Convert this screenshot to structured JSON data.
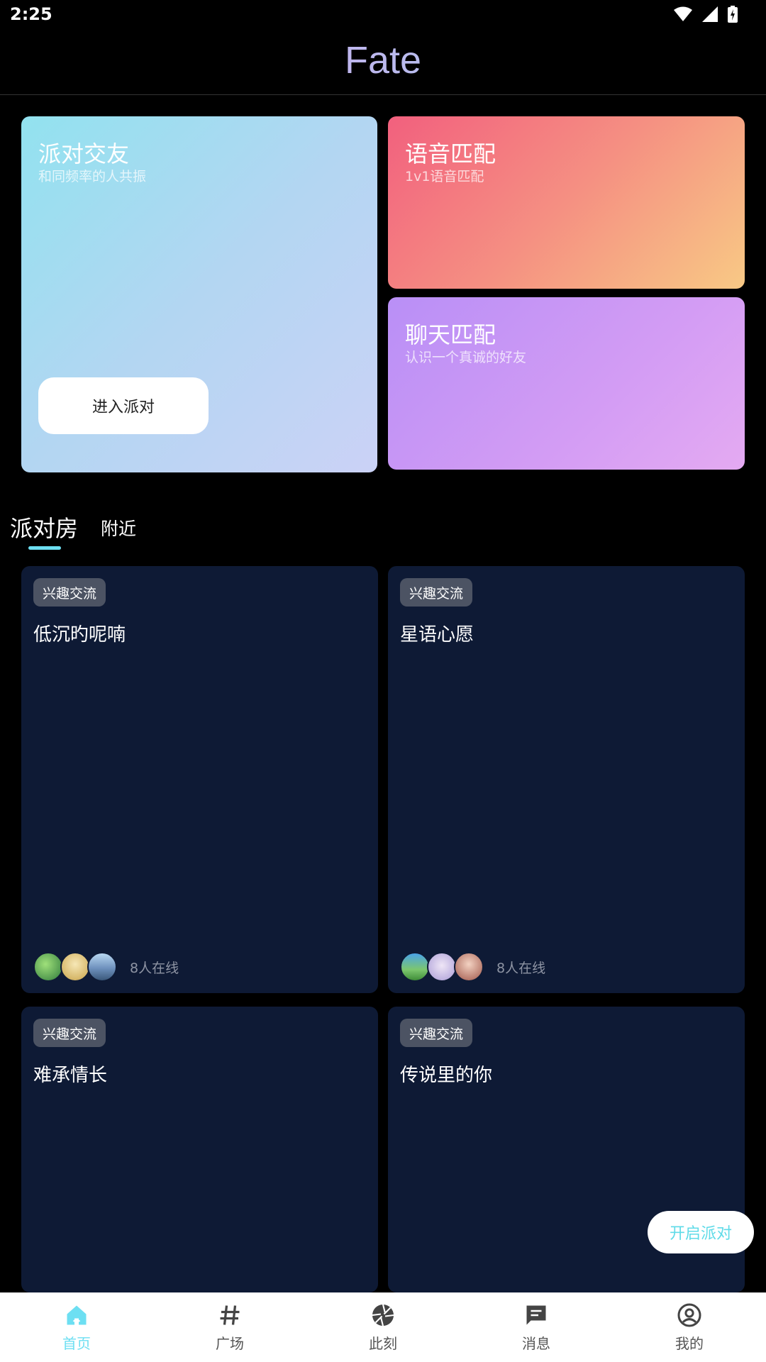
{
  "status_bar": {
    "time": "2:25"
  },
  "header": {
    "title": "Fate"
  },
  "feature_cards": {
    "party": {
      "title": "派对交友",
      "subtitle": "和同频率的人共振",
      "button": "进入派对"
    },
    "voice": {
      "title": "语音匹配",
      "subtitle": "1v1语音匹配"
    },
    "chat": {
      "title": "聊天匹配",
      "subtitle": "认识一个真诚的好友"
    }
  },
  "tabs": {
    "active": "派对房",
    "other": "附近"
  },
  "rooms": [
    {
      "tag": "兴趣交流",
      "name": "低沉旳呢喃",
      "online": "8人在线"
    },
    {
      "tag": "兴趣交流",
      "name": "星语心愿",
      "online": "8人在线"
    },
    {
      "tag": "兴趣交流",
      "name": "难承情长"
    },
    {
      "tag": "兴趣交流",
      "name": "传说里的你"
    }
  ],
  "fab": {
    "label": "开启派对"
  },
  "bottom_nav": [
    {
      "label": "首页",
      "icon": "home-icon",
      "active": true
    },
    {
      "label": "广场",
      "icon": "hash-icon"
    },
    {
      "label": "此刻",
      "icon": "aperture-icon"
    },
    {
      "label": "消息",
      "icon": "message-icon"
    },
    {
      "label": "我的",
      "icon": "profile-icon"
    }
  ],
  "colors": {
    "accent": "#6ddff2",
    "room_card_bg": "#0e1a35",
    "tag_bg": "#4c5363"
  }
}
